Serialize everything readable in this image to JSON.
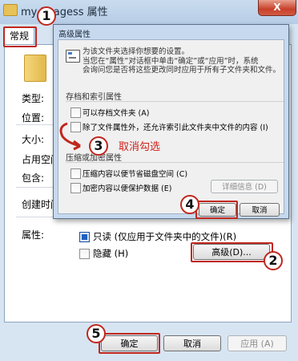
{
  "window": {
    "title": "my imagess 属性",
    "close_glyph": "X"
  },
  "tabs": [
    {
      "label": "常规"
    }
  ],
  "properties": {
    "type_label": "类型:",
    "location_label": "位置:",
    "size_label": "大小:",
    "size_on_disk_label": "占用空间",
    "contains_label": "包含:",
    "created_label": "创建时间",
    "attributes_label": "属性:",
    "readonly_label": "只读 (仅应用于文件夹中的文件)(R)",
    "hidden_label": "隐藏 (H)",
    "advanced_button": "高级(D)..."
  },
  "advanced_dialog": {
    "title": "高级属性",
    "info_line1": "为该文件夹选择你想要的设置。",
    "info_line2": "当您在“属性”对话框中单击“确定”或“应用”时，系统",
    "info_line3": "会询问您是否将这些更改同时应用于所有子文件夹和文件。",
    "archive_group": "存档和索引属性",
    "archive_label": "可以存档文件夹 (A)",
    "index_label": "除了文件属性外，还允许索引此文件夹中文件的内容 (I)",
    "compress_group": "压缩或加密属性",
    "compress_label": "压缩内容以便节省磁盘空间 (C)",
    "encrypt_label": "加密内容以便保护数据 (E)",
    "details_button": "详细信息 (D)",
    "ok_button": "确定",
    "cancel_button": "取消"
  },
  "bottom_buttons": {
    "ok": "确定",
    "cancel": "取消",
    "apply": "应用 (A)"
  },
  "annotations": {
    "step1": "1",
    "step2": "2",
    "step3": "3",
    "step4": "4",
    "step5": "5",
    "uncheck_note": "取消勾选"
  },
  "state": {
    "readonly_checked": true,
    "hidden_checked": false,
    "archive_checked": false,
    "index_checked": false
  },
  "colors": {
    "annotation_red": "#c0271d",
    "title_bar": "#b7cde6"
  }
}
